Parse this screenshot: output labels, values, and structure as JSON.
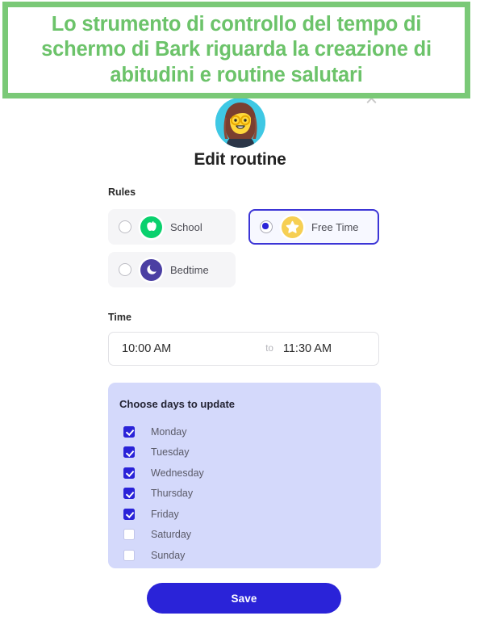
{
  "caption": {
    "text": "Lo strumento di controllo del tempo di schermo di Bark riguarda la creazione di abitudini e routine salutari",
    "border_color": "#7ac977",
    "text_color": "#6cc36a"
  },
  "dialog": {
    "close_icon": "close-icon",
    "avatar_icon": "girl-with-glasses-avatar",
    "title": "Edit routine",
    "rules": {
      "label": "Rules",
      "options": [
        {
          "label": "School",
          "icon": "apple-icon",
          "icon_color": "#0ad16e",
          "selected": false
        },
        {
          "label": "Free Time",
          "icon": "star-icon",
          "icon_color": "#f6cf53",
          "selected": true
        },
        {
          "label": "Bedtime",
          "icon": "moon-icon",
          "icon_color": "#4b3fa3",
          "selected": false
        }
      ]
    },
    "time": {
      "label": "Time",
      "start": "10:00 AM",
      "separator": "to",
      "end": "11:30 AM"
    },
    "days": {
      "title": "Choose days to update",
      "panel_color": "#d4d9fb",
      "items": [
        {
          "label": "Monday",
          "checked": true
        },
        {
          "label": "Tuesday",
          "checked": true
        },
        {
          "label": "Wednesday",
          "checked": true
        },
        {
          "label": "Thursday",
          "checked": true
        },
        {
          "label": "Friday",
          "checked": true
        },
        {
          "label": "Saturday",
          "checked": false
        },
        {
          "label": "Sunday",
          "checked": false
        }
      ]
    },
    "save_label": "Save",
    "accent_color": "#2a23d8"
  }
}
